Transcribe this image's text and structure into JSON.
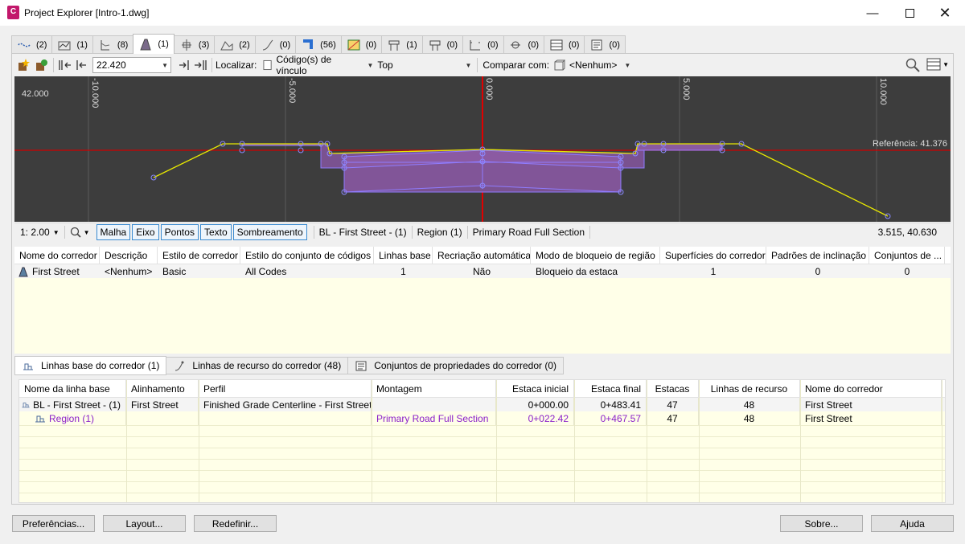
{
  "window": {
    "title": "Project Explorer [Intro-1.dwg]",
    "app_icon_letter": "C"
  },
  "tabs": [
    {
      "icon": "alignment-icon",
      "count": "(2)"
    },
    {
      "icon": "profile-view-icon",
      "count": "(1)"
    },
    {
      "icon": "profile-icon",
      "count": "(8)"
    },
    {
      "icon": "corridor-icon",
      "count": "(1)"
    },
    {
      "icon": "sample-line-icon",
      "count": "(3)"
    },
    {
      "icon": "surface-icon",
      "count": "(2)"
    },
    {
      "icon": "feature-line-icon",
      "count": "(0)"
    },
    {
      "icon": "pipe-icon",
      "count": "(56)"
    },
    {
      "icon": "parcel-icon",
      "count": "(0)"
    },
    {
      "icon": "assembly-icon",
      "count": "(1)"
    },
    {
      "icon": "subassembly-icon",
      "count": "(0)"
    },
    {
      "icon": "section-view-icon",
      "count": "(0)"
    },
    {
      "icon": "intersection-icon",
      "count": "(0)"
    },
    {
      "icon": "table-icon",
      "count": "(0)"
    },
    {
      "icon": "sheet-icon",
      "count": "(0)"
    }
  ],
  "toolbar": {
    "station_value": "22.420",
    "localizar_label": "Localizar:",
    "link_codes_label": "Código(s) de vínculo",
    "top_value": "Top",
    "compare_label": "Comparar com:",
    "compare_value": "<Nenhum>"
  },
  "viewer": {
    "elevation_label": "42.000",
    "reference_label": "Referência: 41.376",
    "offset_labels": [
      "-10.000",
      "-5.000",
      "0.000",
      "5.000",
      "10.000"
    ]
  },
  "statusbar": {
    "scale": "1: 2.00",
    "toggles": [
      "Malha",
      "Eixo",
      "Pontos",
      "Texto",
      "Sombreamento"
    ],
    "baseline": "BL - First Street - (1)",
    "region": "Region (1)",
    "assembly": "Primary Road Full Section",
    "coords": "3.515, 40.630"
  },
  "corridor_table": {
    "headers": [
      "Nome do corredor",
      "Descrição",
      "Estilo de corredor",
      "Estilo do conjunto de códigos",
      "Linhas base",
      "Recriação automática",
      "Modo de bloqueio de região",
      "Superfícies do corredor",
      "Padrões de inclinação",
      "Conjuntos de ..."
    ],
    "row": [
      "First Street",
      "<Nenhum>",
      "Basic",
      "All Codes",
      "1",
      "Não",
      "Bloqueio da estaca",
      "1",
      "0",
      "0"
    ]
  },
  "bottom_tabs": [
    "Linhas base do corredor (1)",
    "Linhas de recurso do corredor (48)",
    "Conjuntos de propriedades do corredor (0)"
  ],
  "baseline_table": {
    "headers": [
      "Nome da linha base",
      "Alinhamento",
      "Perfil",
      "Montagem",
      "Estaca inicial",
      "Estaca final",
      "Estacas",
      "Linhas de recurso",
      "Nome do corredor"
    ],
    "rows": [
      [
        "BL - First Street - (1)",
        "First Street",
        "Finished Grade Centerline - First Street",
        "",
        "0+000.00",
        "0+483.41",
        "47",
        "48",
        "First Street"
      ],
      [
        "Region (1)",
        "",
        "",
        "Primary Road Full Section",
        "0+022.42",
        "0+467.57",
        "47",
        "48",
        "First Street"
      ]
    ]
  },
  "buttons": {
    "preferences": "Preferências...",
    "layout": "Layout...",
    "reset": "Redefinir...",
    "about": "Sobre...",
    "help": "Ajuda"
  },
  "colors": {
    "viewer_bg": "#3d3d3d",
    "centerline": "#e00000",
    "grade_line": "#e8e800",
    "region_fill": "#8a5aa0",
    "link_purple": "#8a1fc9",
    "toggle_border": "#3a8ad0"
  }
}
